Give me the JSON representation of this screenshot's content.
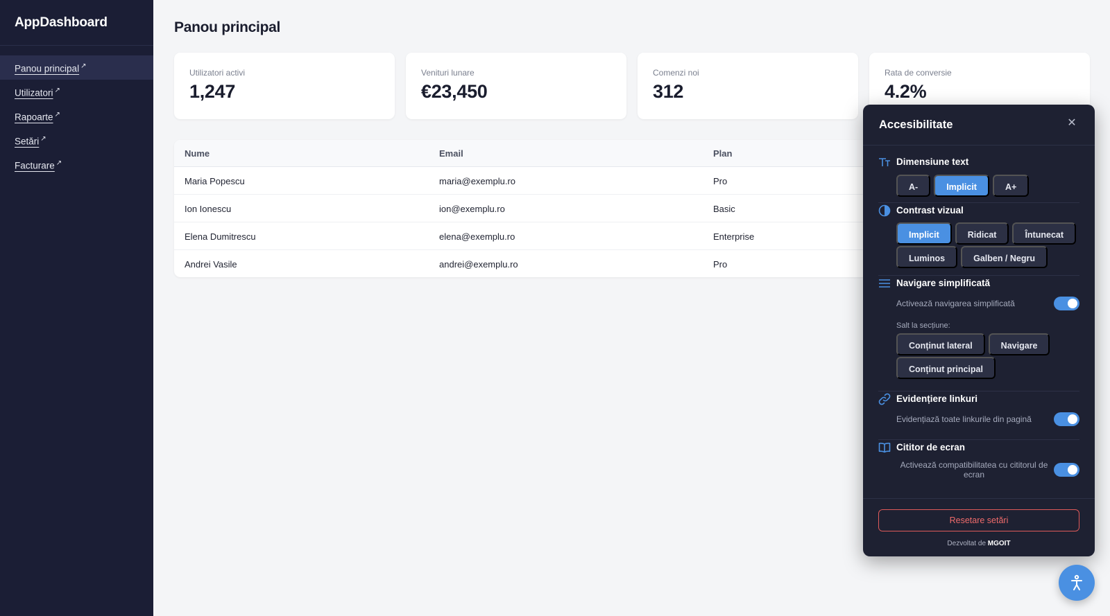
{
  "app": {
    "brand": "AppDashboard"
  },
  "sidebar": {
    "items": [
      {
        "label": "Panou principal",
        "active": true
      },
      {
        "label": "Utilizatori",
        "active": false
      },
      {
        "label": "Rapoarte",
        "active": false
      },
      {
        "label": "Setări",
        "active": false
      },
      {
        "label": "Facturare",
        "active": false
      }
    ],
    "external_icon": "external-link-icon"
  },
  "main": {
    "title": "Panou principal",
    "stats": [
      {
        "label": "Utilizatori activi",
        "value": "1,247"
      },
      {
        "label": "Venituri lunare",
        "value": "€23,450"
      },
      {
        "label": "Comenzi noi",
        "value": "312"
      },
      {
        "label": "Rata de conversie",
        "value": "4.2%"
      }
    ],
    "table": {
      "columns": [
        "Nume",
        "Email",
        "Plan"
      ],
      "rows": [
        [
          "Maria Popescu",
          "maria@exemplu.ro",
          "Pro"
        ],
        [
          "Ion Ionescu",
          "ion@exemplu.ro",
          "Basic"
        ],
        [
          "Elena Dumitrescu",
          "elena@exemplu.ro",
          "Enterprise"
        ],
        [
          "Andrei Vasile",
          "andrei@exemplu.ro",
          "Pro"
        ]
      ]
    }
  },
  "a11y": {
    "title": "Accesibilitate",
    "close_icon": "close-icon",
    "text_size": {
      "title": "Dimensiune text",
      "options": [
        "A-",
        "Implicit",
        "A+"
      ],
      "selected": "Implicit"
    },
    "contrast": {
      "title": "Contrast vizual",
      "options_row1": [
        "Implicit",
        "Ridicat",
        "Întunecat"
      ],
      "options_row2": [
        "Luminos",
        "Galben / Negru"
      ],
      "selected": "Implicit"
    },
    "nav": {
      "title": "Navigare simplificată",
      "toggle_label": "Activează navigarea simplificată",
      "enabled": true,
      "jump_label": "Salt la secțiune:",
      "jump_row1": [
        "Conținut lateral",
        "Navigare"
      ],
      "jump_row2": [
        "Conținut principal"
      ]
    },
    "links": {
      "title": "Evidențiere linkuri",
      "toggle_label": "Evidențiază toate linkurile din pagină",
      "enabled": true
    },
    "reader": {
      "title": "Cititor de ecran",
      "toggle_label": "Activează compatibilitatea cu cititorul de ecran",
      "enabled": true
    },
    "reset_label": "Resetare setări",
    "credit_prefix": "Dezvoltat de",
    "credit_brand": "MGOIT"
  },
  "colors": {
    "sidebar_bg": "#1b1e35",
    "accent": "#4a90e2",
    "panel_bg": "#1e2132",
    "danger": "#e05a5a"
  },
  "fab": {
    "icon": "accessibility-person-icon"
  }
}
